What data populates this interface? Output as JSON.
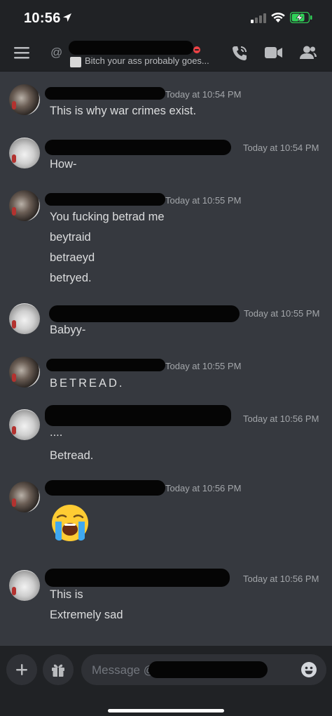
{
  "status_bar": {
    "time": "10:56"
  },
  "header": {
    "at_symbol": "@",
    "subtitle": "Bitch your ass probably goes..."
  },
  "messages": [
    {
      "timestamp": "Today at 10:54 PM",
      "lines": [
        "This is why war crimes exist."
      ]
    },
    {
      "timestamp": "Today at 10:54 PM",
      "lines": [
        "How-"
      ]
    },
    {
      "timestamp": "Today at 10:55 PM",
      "lines": [
        "You fucking betrad me",
        "beytraid",
        "betraeyd",
        "betryed."
      ]
    },
    {
      "timestamp": "Today at 10:55 PM",
      "lines": [
        "Babyy-"
      ]
    },
    {
      "timestamp": "Today at 10:55 PM",
      "lines": [
        "BETREAD."
      ]
    },
    {
      "timestamp": "Today at 10:56 PM",
      "lines": [
        "....",
        "Betread."
      ]
    },
    {
      "timestamp": "Today at 10:56 PM",
      "lines": [],
      "emoji": "loudly-crying-face"
    },
    {
      "timestamp": "Today at 10:56 PM",
      "lines": [
        "This is",
        "Extremely sad"
      ]
    }
  ],
  "composer": {
    "placeholder": "Message @"
  },
  "colors": {
    "background": "#36393f",
    "bars": "#202225",
    "text": "#dcddde",
    "timestamp": "#a3a6aa",
    "battery_green": "#30d158",
    "dnd_red": "#ed4245"
  }
}
